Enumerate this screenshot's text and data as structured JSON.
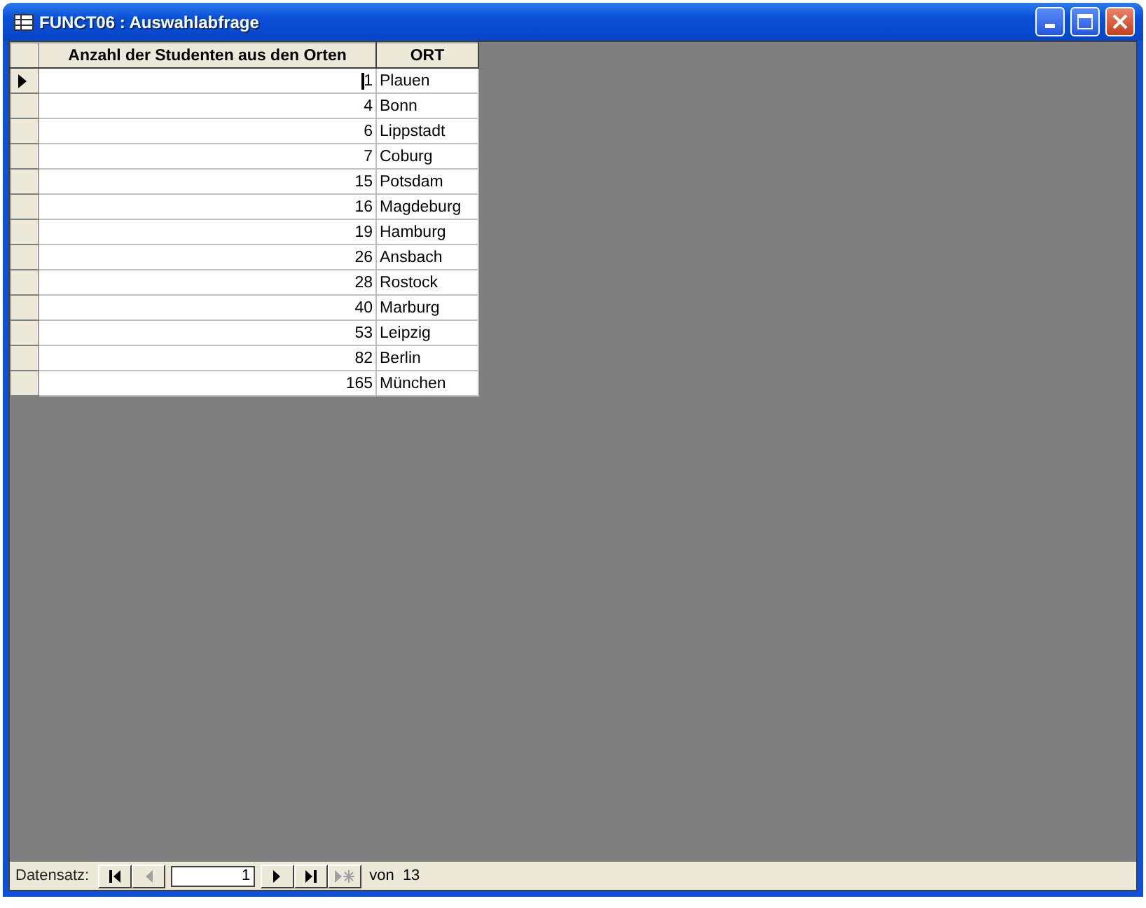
{
  "window": {
    "title": "FUNCT06 : Auswahlabfrage"
  },
  "table": {
    "columns": [
      "Anzahl der Studenten aus den Orten",
      "ORT"
    ],
    "rows": [
      {
        "count": "1",
        "ort": "Plauen",
        "selected": true
      },
      {
        "count": "4",
        "ort": "Bonn",
        "selected": false
      },
      {
        "count": "6",
        "ort": "Lippstadt",
        "selected": false
      },
      {
        "count": "7",
        "ort": "Coburg",
        "selected": false
      },
      {
        "count": "15",
        "ort": "Potsdam",
        "selected": false
      },
      {
        "count": "16",
        "ort": "Magdeburg",
        "selected": false
      },
      {
        "count": "19",
        "ort": "Hamburg",
        "selected": false
      },
      {
        "count": "26",
        "ort": "Ansbach",
        "selected": false
      },
      {
        "count": "28",
        "ort": "Rostock",
        "selected": false
      },
      {
        "count": "40",
        "ort": "Marburg",
        "selected": false
      },
      {
        "count": "53",
        "ort": "Leipzig",
        "selected": false
      },
      {
        "count": "82",
        "ort": "Berlin",
        "selected": false
      },
      {
        "count": "165",
        "ort": "München",
        "selected": false
      }
    ]
  },
  "navigation": {
    "label": "Datensatz:",
    "record": "1",
    "total": "von  13",
    "buttons": [
      {
        "kind": "first",
        "disabled": false
      },
      {
        "kind": "prev",
        "disabled": true
      },
      {
        "kind": "field"
      },
      {
        "kind": "next",
        "disabled": false
      },
      {
        "kind": "last",
        "disabled": false
      },
      {
        "kind": "new",
        "disabled": true
      }
    ]
  }
}
